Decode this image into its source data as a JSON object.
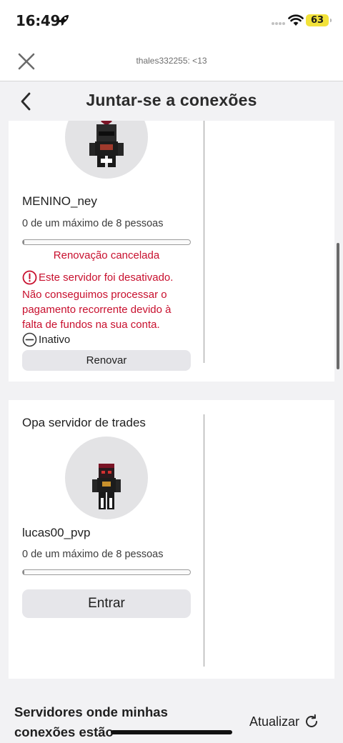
{
  "status_bar": {
    "time": "16:49",
    "battery": "63",
    "battery_color": "#f2e23a"
  },
  "browser": {
    "close_icon": "close-icon",
    "url_text": "thales332255: <13"
  },
  "header": {
    "back_icon": "chevron-left-icon",
    "title": "Juntar-se a conexões"
  },
  "servers": [
    {
      "owner": "MENINO_ney",
      "capacity": "0 de um máximo de 8 pessoas",
      "occupancy_fraction": 0,
      "renewal_status": "Renovação cancelada",
      "warning_title": "Este servidor foi desativado.",
      "warning_body": "Não conseguimos processar o pagamento recorrente devido à falta de fundos na sua conta.",
      "status": "Inativo",
      "action_label": "Renovar"
    },
    {
      "name": "Opa servidor de trades",
      "owner": "lucas00_pvp",
      "capacity": "0 de um máximo de 8 pessoas",
      "occupancy_fraction": 0,
      "action_label": "Entrar"
    }
  ],
  "section": {
    "title": "Servidores onde minhas conexões estão",
    "refresh_label": "Atualizar",
    "refresh_icon": "refresh-icon"
  },
  "colors": {
    "error": "#c8102e",
    "button_bg": "#e6e6ea",
    "page_bg": "#f2f2f4"
  }
}
